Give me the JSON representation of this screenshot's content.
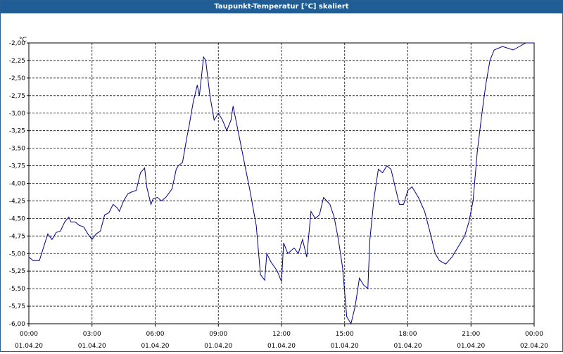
{
  "window": {
    "title": "Taupunkt-Temperatur [°C] skaliert"
  },
  "chart_data": {
    "type": "line",
    "title": "Taupunkt-Temperatur [°C] skaliert",
    "ylabel": "°C",
    "xlabel": "",
    "ylim": [
      -6.0,
      -2.0
    ],
    "yticks": [
      -2.0,
      -2.25,
      -2.5,
      -2.75,
      -3.0,
      -3.25,
      -3.5,
      -3.75,
      -4.0,
      -4.25,
      -4.5,
      -4.75,
      -5.0,
      -5.25,
      -5.5,
      -5.75,
      -6.0
    ],
    "ytick_labels": [
      "-2,00",
      "-2,25",
      "-2,50",
      "-2,75",
      "-3,00",
      "-3,25",
      "-3,50",
      "-3,75",
      "-4,00",
      "-4,25",
      "-4,50",
      "-4,75",
      "-5,00",
      "-5,25",
      "-5,50",
      "-5,75",
      "-6,00"
    ],
    "xlim": [
      0,
      24
    ],
    "xticks": [
      {
        "time": "00:00",
        "date": "01.04.20"
      },
      {
        "time": "03:00",
        "date": "01.04.20"
      },
      {
        "time": "06:00",
        "date": "01.04.20"
      },
      {
        "time": "09:00",
        "date": "01.04.20"
      },
      {
        "time": "12:00",
        "date": "01.04.20"
      },
      {
        "time": "15:00",
        "date": "01.04.20"
      },
      {
        "time": "18:00",
        "date": "01.04.20"
      },
      {
        "time": "21:00",
        "date": "01.04.20"
      },
      {
        "time": "00:00",
        "date": "02.04.20"
      }
    ],
    "grid": true,
    "line_color": "#00008b",
    "series": [
      {
        "x": [
          0.0,
          0.2,
          0.5,
          0.9,
          1.1,
          1.3,
          1.5,
          1.7,
          1.9,
          2.0,
          2.2,
          2.4,
          2.6,
          2.8,
          3.0,
          3.2,
          3.4,
          3.6,
          3.8,
          4.0,
          4.2,
          4.3,
          4.5,
          4.7,
          4.9,
          5.1,
          5.3,
          5.5,
          5.6,
          5.8,
          5.9,
          6.1,
          6.3,
          6.5,
          6.8,
          7.0,
          7.1,
          7.3,
          7.5,
          7.6,
          7.8,
          8.0,
          8.1,
          8.3,
          8.4,
          8.6,
          8.8,
          9.0,
          9.2,
          9.4,
          9.6,
          9.7,
          9.9,
          10.1,
          10.3,
          10.5,
          10.8,
          11.0,
          11.2,
          11.3,
          11.5,
          11.8,
          12.0,
          12.1,
          12.3,
          12.6,
          12.8,
          13.0,
          13.2,
          13.4,
          13.6,
          13.8,
          14.0,
          14.3,
          14.5,
          14.7,
          14.9,
          15.1,
          15.3,
          15.5,
          15.7,
          15.9,
          16.1,
          16.2,
          16.4,
          16.6,
          16.8,
          17.0,
          17.2,
          17.4,
          17.6,
          17.8,
          18.0,
          18.2,
          18.5,
          18.8,
          19.1,
          19.3,
          19.5,
          19.8,
          20.1,
          20.4,
          20.7,
          20.9,
          21.1,
          21.3,
          21.5,
          21.7,
          21.9,
          22.1,
          22.5,
          23.0,
          23.3,
          23.6,
          24.0
        ],
        "y": [
          -5.05,
          -5.1,
          -5.1,
          -4.72,
          -4.8,
          -4.7,
          -4.68,
          -4.55,
          -4.48,
          -4.55,
          -4.55,
          -4.6,
          -4.62,
          -4.72,
          -4.8,
          -4.72,
          -4.68,
          -4.45,
          -4.42,
          -4.3,
          -4.35,
          -4.4,
          -4.25,
          -4.15,
          -4.12,
          -4.1,
          -3.85,
          -3.78,
          -4.05,
          -4.3,
          -4.22,
          -4.2,
          -4.25,
          -4.2,
          -4.08,
          -3.8,
          -3.75,
          -3.7,
          -3.35,
          -3.2,
          -2.85,
          -2.6,
          -2.75,
          -2.2,
          -2.25,
          -2.75,
          -3.1,
          -3.0,
          -3.1,
          -3.25,
          -3.1,
          -2.9,
          -3.2,
          -3.5,
          -3.8,
          -4.1,
          -4.6,
          -5.3,
          -5.38,
          -5.0,
          -5.12,
          -5.25,
          -5.4,
          -4.85,
          -5.0,
          -4.92,
          -5.0,
          -4.8,
          -5.05,
          -4.4,
          -4.5,
          -4.45,
          -4.2,
          -4.3,
          -4.48,
          -4.8,
          -5.2,
          -5.9,
          -6.0,
          -5.75,
          -5.35,
          -5.45,
          -5.5,
          -4.8,
          -4.2,
          -3.8,
          -3.85,
          -3.75,
          -3.8,
          -4.05,
          -4.3,
          -4.3,
          -4.1,
          -4.05,
          -4.2,
          -4.4,
          -4.75,
          -5.0,
          -5.1,
          -5.15,
          -5.05,
          -4.9,
          -4.75,
          -4.55,
          -4.25,
          -3.55,
          -3.05,
          -2.6,
          -2.25,
          -2.1,
          -2.05,
          -2.1,
          -2.05,
          -2.0,
          -2.0
        ]
      }
    ]
  }
}
